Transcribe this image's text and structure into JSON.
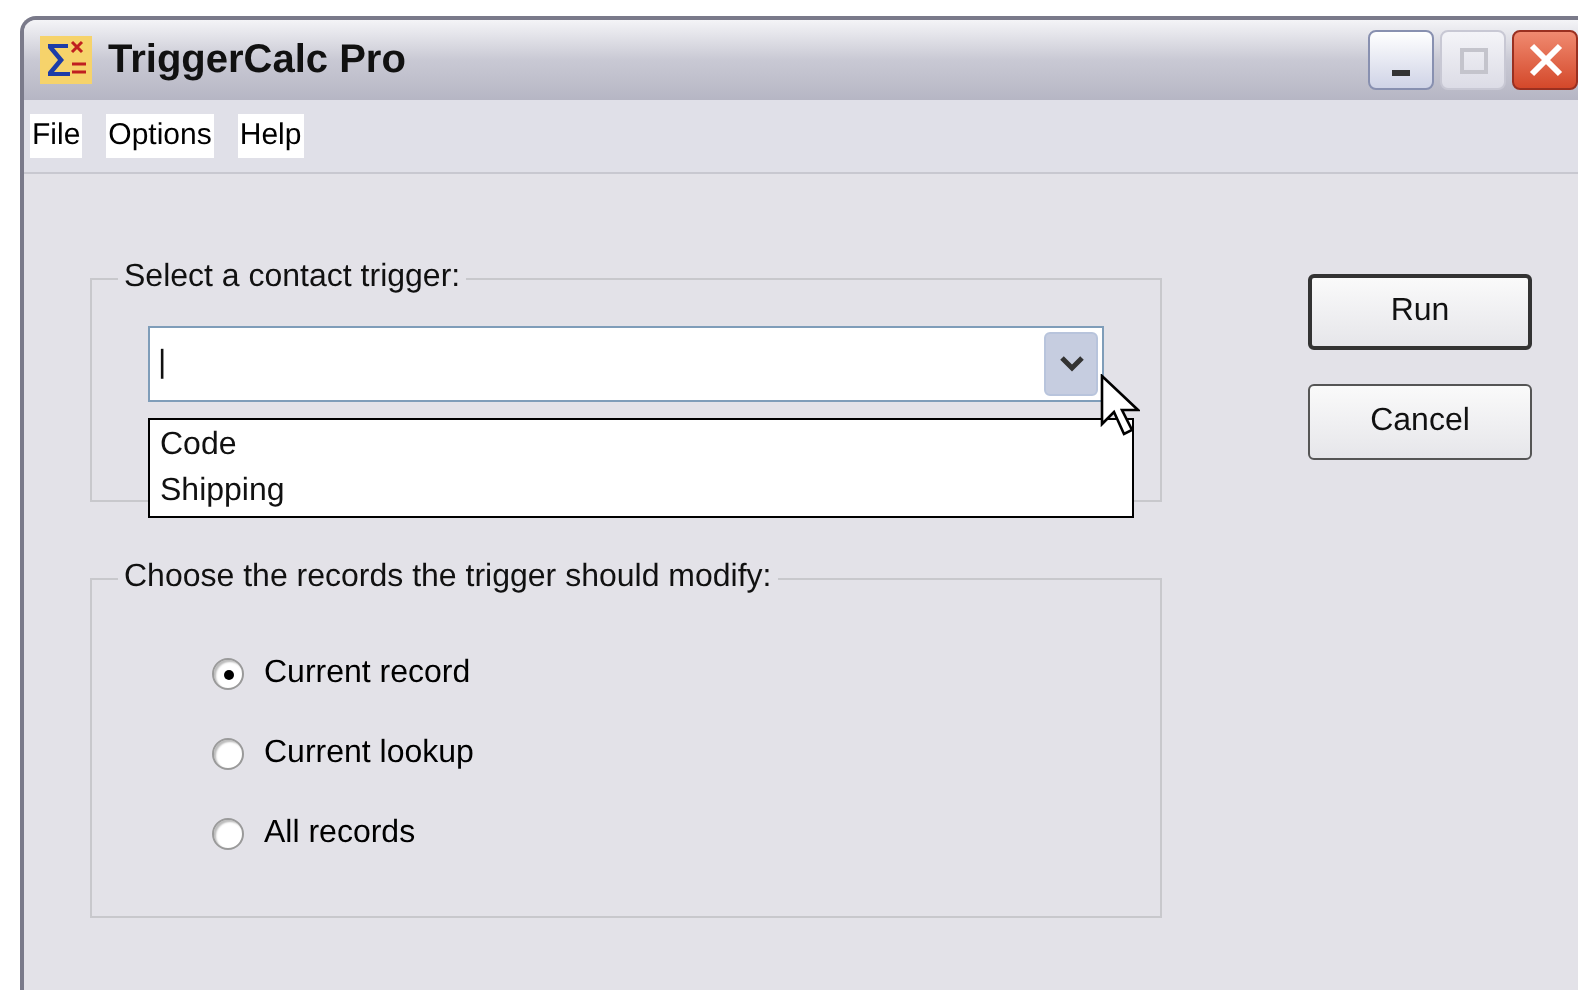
{
  "window": {
    "title": "TriggerCalc Pro"
  },
  "menu": [
    "File",
    "Options",
    "Help"
  ],
  "trigger_group": {
    "label": "Select a contact trigger:",
    "combo": {
      "value": "|",
      "expanded": true,
      "options": [
        "Code",
        "Shipping"
      ]
    }
  },
  "records_group": {
    "label": "Choose the records the trigger should modify:",
    "options": [
      {
        "label": "Current record",
        "selected": true
      },
      {
        "label": "Current lookup",
        "selected": false
      },
      {
        "label": "All records",
        "selected": false
      }
    ]
  },
  "buttons": [
    "Run",
    "Cancel"
  ]
}
